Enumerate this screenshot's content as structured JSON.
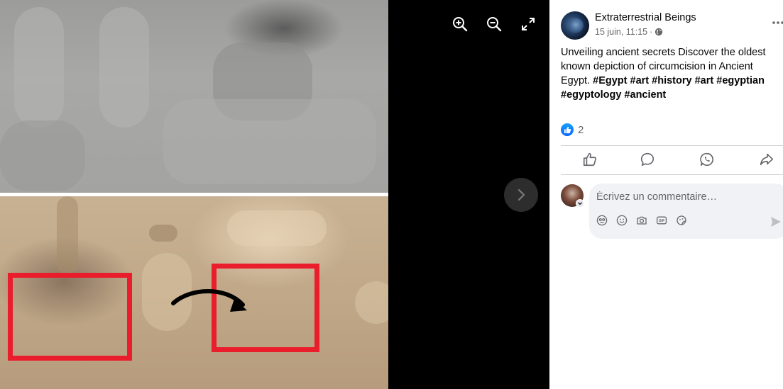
{
  "viewer": {
    "zoom_in_icon": "zoom-in-icon",
    "zoom_out_icon": "zoom-out-icon",
    "fullscreen_icon": "fullscreen-icon",
    "next_icon": "chevron-right-icon"
  },
  "post": {
    "page_name": "Extraterrestrial Beings",
    "timestamp": "15 juin, 11:15",
    "separator": "·",
    "audience_icon": "globe-icon",
    "text_plain": "Unveiling ancient secrets Discover the oldest known depiction of circumcision in Ancient Egypt.",
    "hashtags": [
      "#Egypt",
      "#art",
      "#history",
      "#art",
      "#egyptian",
      "#egyptology",
      "#ancient"
    ],
    "reaction_count": "2"
  },
  "actions": {
    "like_icon": "thumbs-up-icon",
    "comment_icon": "comment-bubble-icon",
    "whatsapp_icon": "whatsapp-icon",
    "share_icon": "share-arrow-icon"
  },
  "comment": {
    "placeholder": "Écrivez un commentaire…",
    "tools": [
      "avatar-sticker-icon",
      "emoji-icon",
      "camera-icon",
      "gif-icon",
      "sticker-icon"
    ]
  },
  "colors": {
    "accent": "#0866ff",
    "highlight_box": "#ea1d2c"
  }
}
